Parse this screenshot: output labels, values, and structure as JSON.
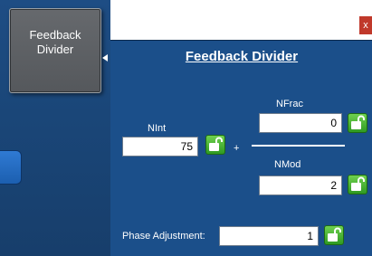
{
  "sidebar": {
    "block_button_label": "Feedback\nDivider"
  },
  "panel": {
    "title": "Feedback Divider",
    "close_label": "x"
  },
  "fields": {
    "nint": {
      "label": "NInt",
      "value": "75"
    },
    "nfrac": {
      "label": "NFrac",
      "value": "0"
    },
    "nmod": {
      "label": "NMod",
      "value": "2"
    },
    "phase_adjustment": {
      "label": "Phase Adjustment:",
      "value": "1"
    }
  },
  "operators": {
    "plus": "+"
  },
  "icons": {
    "lock": "unlocked-padlock-icon",
    "lock_color": "#3fae2c"
  }
}
